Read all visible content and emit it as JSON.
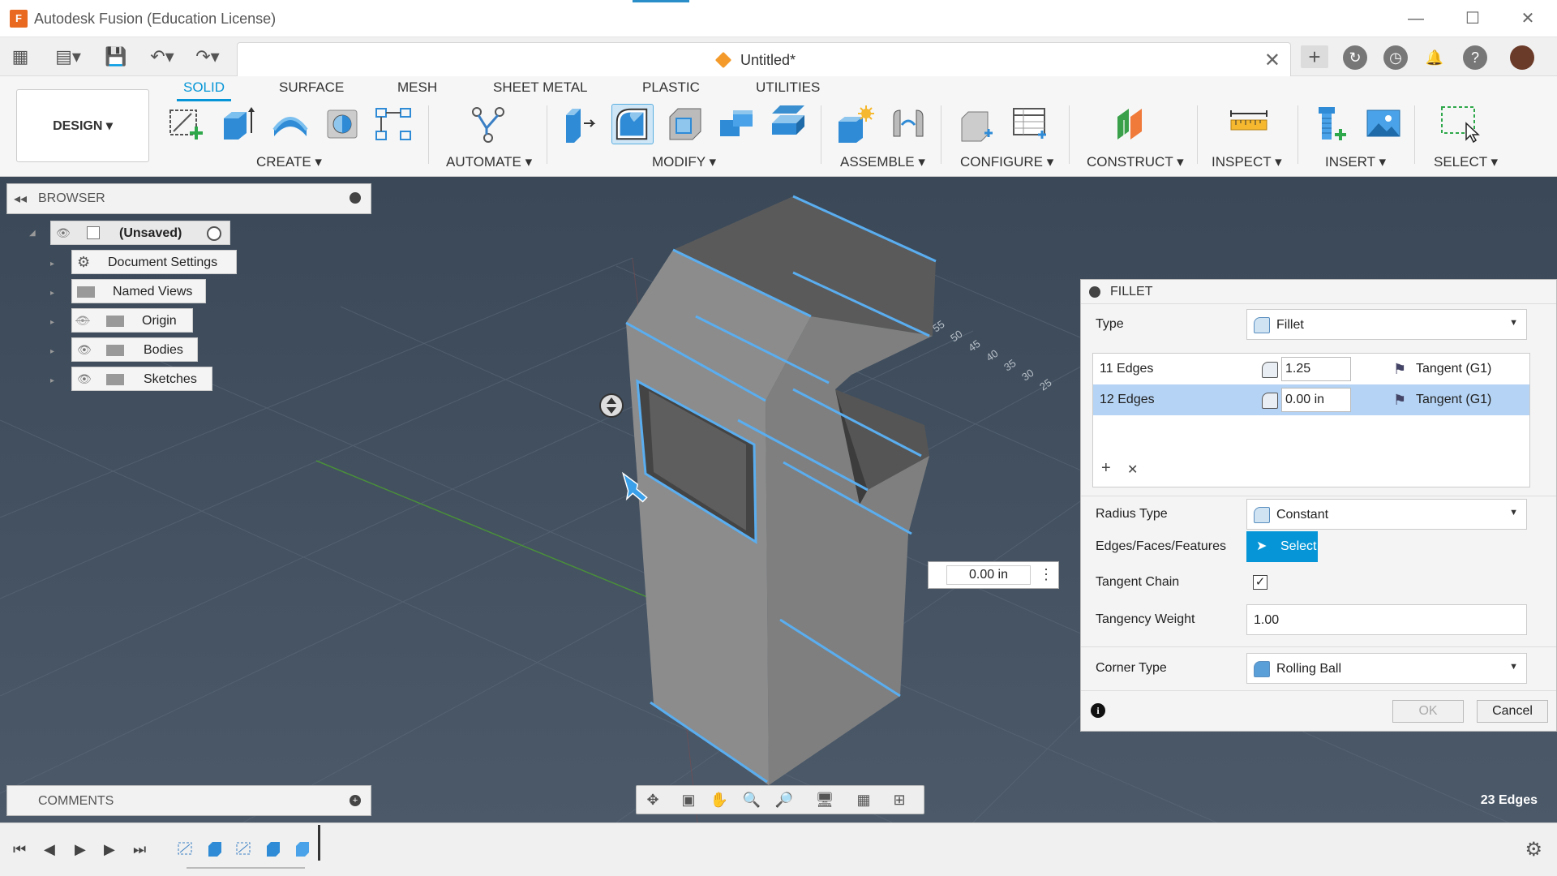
{
  "window": {
    "app_title": "Autodesk Fusion (Education License)",
    "app_icon_letter": "F",
    "minimize": "—",
    "maximize": "☐",
    "close": "✕"
  },
  "doc_tab": {
    "title": "Untitled*",
    "close": "✕"
  },
  "qat": {
    "grid": "▦",
    "file": "▤▾",
    "save": "💾",
    "undo": "↶▾",
    "redo": "↷▾",
    "new_tab": "+",
    "extensions": "↻",
    "job_status": "◷",
    "notifications": "🔔",
    "help": "?"
  },
  "workspace": {
    "label": "DESIGN ▾"
  },
  "tabs": [
    {
      "label": "SOLID"
    },
    {
      "label": "SURFACE"
    },
    {
      "label": "MESH"
    },
    {
      "label": "SHEET METAL"
    },
    {
      "label": "PLASTIC"
    },
    {
      "label": "UTILITIES"
    }
  ],
  "groups": [
    {
      "label": "CREATE ▾"
    },
    {
      "label": "AUTOMATE ▾"
    },
    {
      "label": "MODIFY ▾"
    },
    {
      "label": "ASSEMBLE ▾"
    },
    {
      "label": "CONFIGURE ▾"
    },
    {
      "label": "CONSTRUCT ▾"
    },
    {
      "label": "INSPECT ▾"
    },
    {
      "label": "INSERT ▾"
    },
    {
      "label": "SELECT ▾"
    }
  ],
  "browser": {
    "title": "BROWSER",
    "collapse": "◂◂",
    "root": "(Unsaved)",
    "items": [
      {
        "label": "Document Settings"
      },
      {
        "label": "Named Views"
      },
      {
        "label": "Origin"
      },
      {
        "label": "Bodies"
      },
      {
        "label": "Sketches"
      }
    ]
  },
  "comments": {
    "title": "COMMENTS",
    "add": "+"
  },
  "viewport": {
    "edge_count": "23 Edges",
    "floating_value": "0.00 in",
    "floating_menu": "⋮",
    "grid_labels": [
      "55",
      "50",
      "45",
      "40",
      "35",
      "30",
      "25"
    ]
  },
  "navbar": {
    "orbit": "✥",
    "look_at": "▣",
    "pan": "✋",
    "zoom": "🔍",
    "fit": "🔎",
    "display": "🖥",
    "grid": "▦",
    "viewports": "⊞"
  },
  "fillet": {
    "title": "FILLET",
    "type_label": "Type",
    "type_value": "Fillet",
    "edge_rows": [
      {
        "name": "11 Edges",
        "value": "1.25",
        "tangency": "Tangent (G1)"
      },
      {
        "name": "12 Edges",
        "value": "0.00 in",
        "tangency": "Tangent (G1)"
      }
    ],
    "add": "+",
    "remove": "✕",
    "radius_type_label": "Radius Type",
    "radius_type_value": "Constant",
    "edges_label": "Edges/Faces/Features",
    "select_label": "Select",
    "tangent_chain_label": "Tangent Chain",
    "tangent_chain_check": "✓",
    "tangency_weight_label": "Tangency Weight",
    "tangency_weight_value": "1.00",
    "corner_type_label": "Corner Type",
    "corner_type_value": "Rolling Ball",
    "ok": "OK",
    "cancel": "Cancel",
    "info": "i"
  },
  "timeline": {
    "first": "⏮",
    "prev": "◀",
    "play": "▶",
    "next": "▶",
    "last": "⏭",
    "settings": "⚙"
  },
  "colors": {
    "accent": "#0696d7",
    "selection_edge": "#5aaef0",
    "body": "#8a8a8a",
    "viewport_bg": "#4a5868"
  }
}
